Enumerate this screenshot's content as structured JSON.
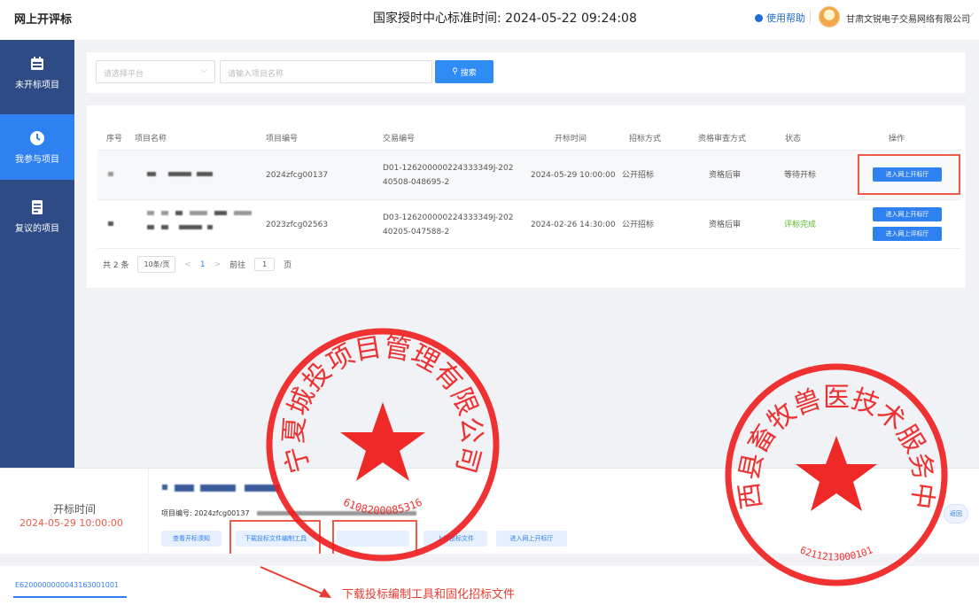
{
  "header": {
    "app_title": "网上开评标",
    "server_time": "国家授时中心标准时间: 2024-05-22 09:24:08",
    "help": "使用帮助",
    "company": "甘肃文锐电子交易网络有限公司"
  },
  "sidebar": {
    "items": [
      {
        "label": "未开标项目",
        "icon": "calendar-icon"
      },
      {
        "label": "我参与项目",
        "icon": "clock-icon"
      },
      {
        "label": "复议的项目",
        "icon": "document-icon"
      }
    ]
  },
  "filter": {
    "platform_placeholder": "请选择平台",
    "name_placeholder": "请输入项目名称",
    "search_label": "搜索"
  },
  "table": {
    "headers": [
      "序号",
      "项目名称",
      "项目编号",
      "交易编号",
      "开标时间",
      "招标方式",
      "资格审查方式",
      "状态",
      "操作"
    ],
    "rows": [
      {
        "project_no": "2024zfcg00137",
        "trade_no_1": "D01-126200000224333349J-202",
        "trade_no_2": "40508-048695-2",
        "open_time": "2024-05-29 10:00:00",
        "method": "公开招标",
        "review": "资格后审",
        "status": "等待开标",
        "op1": "进入网上开标厅"
      },
      {
        "project_no": "2023zfcg02563",
        "trade_no_1": "D03-126200000224333349J-202",
        "trade_no_2": "40205-047588-2",
        "open_time": "2024-02-26 14:30:00",
        "method": "公开招标",
        "review": "资格后审",
        "status": "评标完成",
        "op1": "进入网上开标厅",
        "op2": "进入网上评标厅"
      }
    ]
  },
  "pager": {
    "total": "共 2 条",
    "page_size": "10条/页",
    "prev": "<",
    "page": "1",
    "next": ">",
    "goto": "前往",
    "goto_value": "1",
    "page_unit": "页"
  },
  "bottom": {
    "open_label": "开标时间",
    "open_time": "2024-05-29 10:00:00",
    "project_no_line": "项目编号: 2024zfcg00137",
    "buttons": [
      "查看开标须知",
      "下载投标文件编制工具",
      "",
      "上传投标文件",
      "进入网上开标厅"
    ],
    "right_button": "返回",
    "tab_code": "E6200000000043163001001"
  },
  "annotation": {
    "text": "下载投标编制工具和固化招标文件",
    "color": "#e63b2e"
  },
  "seals": [
    {
      "text": "宁夏城投项目管理有限公司",
      "code": "6108200085316"
    },
    {
      "text": "陇西县畜牧兽医技术服务中心",
      "code": "6211213000101"
    }
  ],
  "colors": {
    "sidebar": "#2f4b86",
    "active": "#2f80f0",
    "accent_red": "#f05a4a",
    "success": "#5cb82c"
  }
}
